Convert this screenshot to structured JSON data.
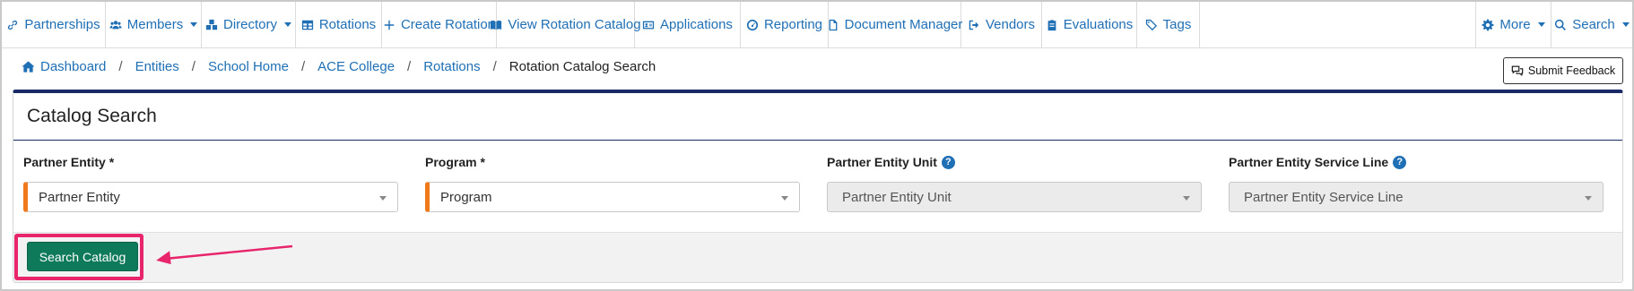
{
  "nav": {
    "items": [
      {
        "label": "Partnerships",
        "icon": "link-icon"
      },
      {
        "label": "Members",
        "icon": "users-icon",
        "dropdown": true
      },
      {
        "label": "Directory",
        "icon": "boxes-icon",
        "dropdown": true
      },
      {
        "label": "Rotations",
        "icon": "table-icon"
      },
      {
        "label": "Create Rotation",
        "icon": "plus-icon"
      },
      {
        "label": "View Rotation Catalog",
        "icon": "book-icon"
      },
      {
        "label": "Applications",
        "icon": "id-card-icon"
      },
      {
        "label": "Reporting",
        "icon": "gauge-icon"
      },
      {
        "label": "Document Manager",
        "icon": "file-icon"
      },
      {
        "label": "Vendors",
        "icon": "sign-out-icon"
      },
      {
        "label": "Evaluations",
        "icon": "clipboard-icon"
      },
      {
        "label": "Tags",
        "icon": "tag-icon"
      },
      {
        "label": "More",
        "icon": "gear-icon",
        "dropdown": true
      },
      {
        "label": "Search",
        "icon": "search-icon",
        "dropdown": true
      }
    ]
  },
  "breadcrumb": {
    "items": [
      "Dashboard",
      "Entities",
      "School Home",
      "ACE College",
      "Rotations"
    ],
    "current": "Rotation Catalog Search",
    "separator": "/"
  },
  "feedback": {
    "label": "Submit Feedback"
  },
  "card": {
    "title": "Catalog Search",
    "fields": [
      {
        "label": "Partner Entity *",
        "placeholder": "Partner Entity",
        "required": true,
        "disabled": false,
        "help": false
      },
      {
        "label": "Program *",
        "placeholder": "Program",
        "required": true,
        "disabled": false,
        "help": false
      },
      {
        "label": "Partner Entity Unit",
        "placeholder": "Partner Entity Unit",
        "required": false,
        "disabled": true,
        "help": true
      },
      {
        "label": "Partner Entity Service Line",
        "placeholder": "Partner Entity Service Line",
        "required": false,
        "disabled": true,
        "help": true
      }
    ],
    "submit_label": "Search Catalog",
    "help_glyph": "?"
  },
  "colors": {
    "link": "#1f6fb5",
    "primary_button": "#0f7a5a",
    "required_marker": "#f07a1a",
    "card_accent": "#1a2a66",
    "annotation": "#e8246a"
  }
}
